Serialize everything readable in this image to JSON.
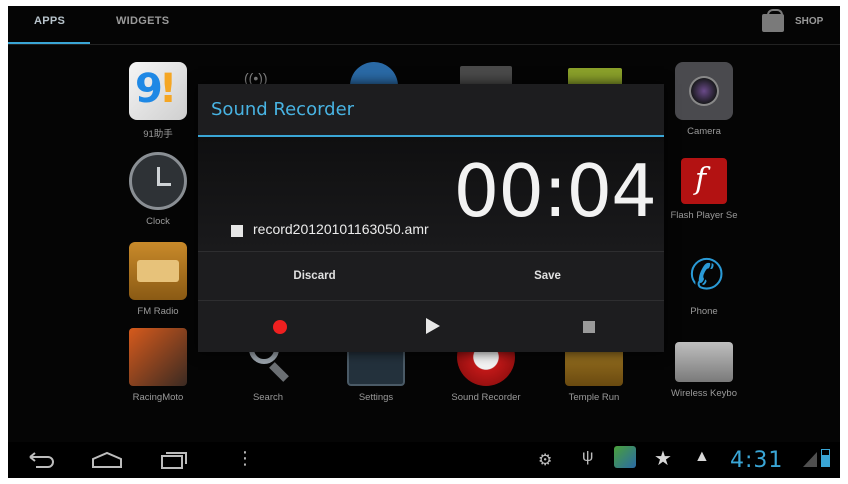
{
  "tabs": {
    "apps": "APPS",
    "widgets": "WIDGETS",
    "shop": "SHOP"
  },
  "apps": {
    "app91": "91助手",
    "clock": "Clock",
    "fm_radio": "FM Radio",
    "racing": "RacingMoto",
    "search": "Search",
    "settings": "Settings",
    "sound_recorder": "Sound Recorder",
    "temple_run": "Temple Run",
    "camera": "Camera",
    "flash": "Flash Player Se",
    "phone": "Phone",
    "keyboard": "Wireless Keybo"
  },
  "dialog": {
    "title": "Sound Recorder",
    "timer": "00:04",
    "file_name": "record20120101163050.amr",
    "discard_label": "Discard",
    "save_label": "Save"
  },
  "statusbar": {
    "time": "4:31"
  },
  "colors": {
    "accent": "#3aa6d6",
    "record": "#ef2020",
    "background": "#050505"
  }
}
